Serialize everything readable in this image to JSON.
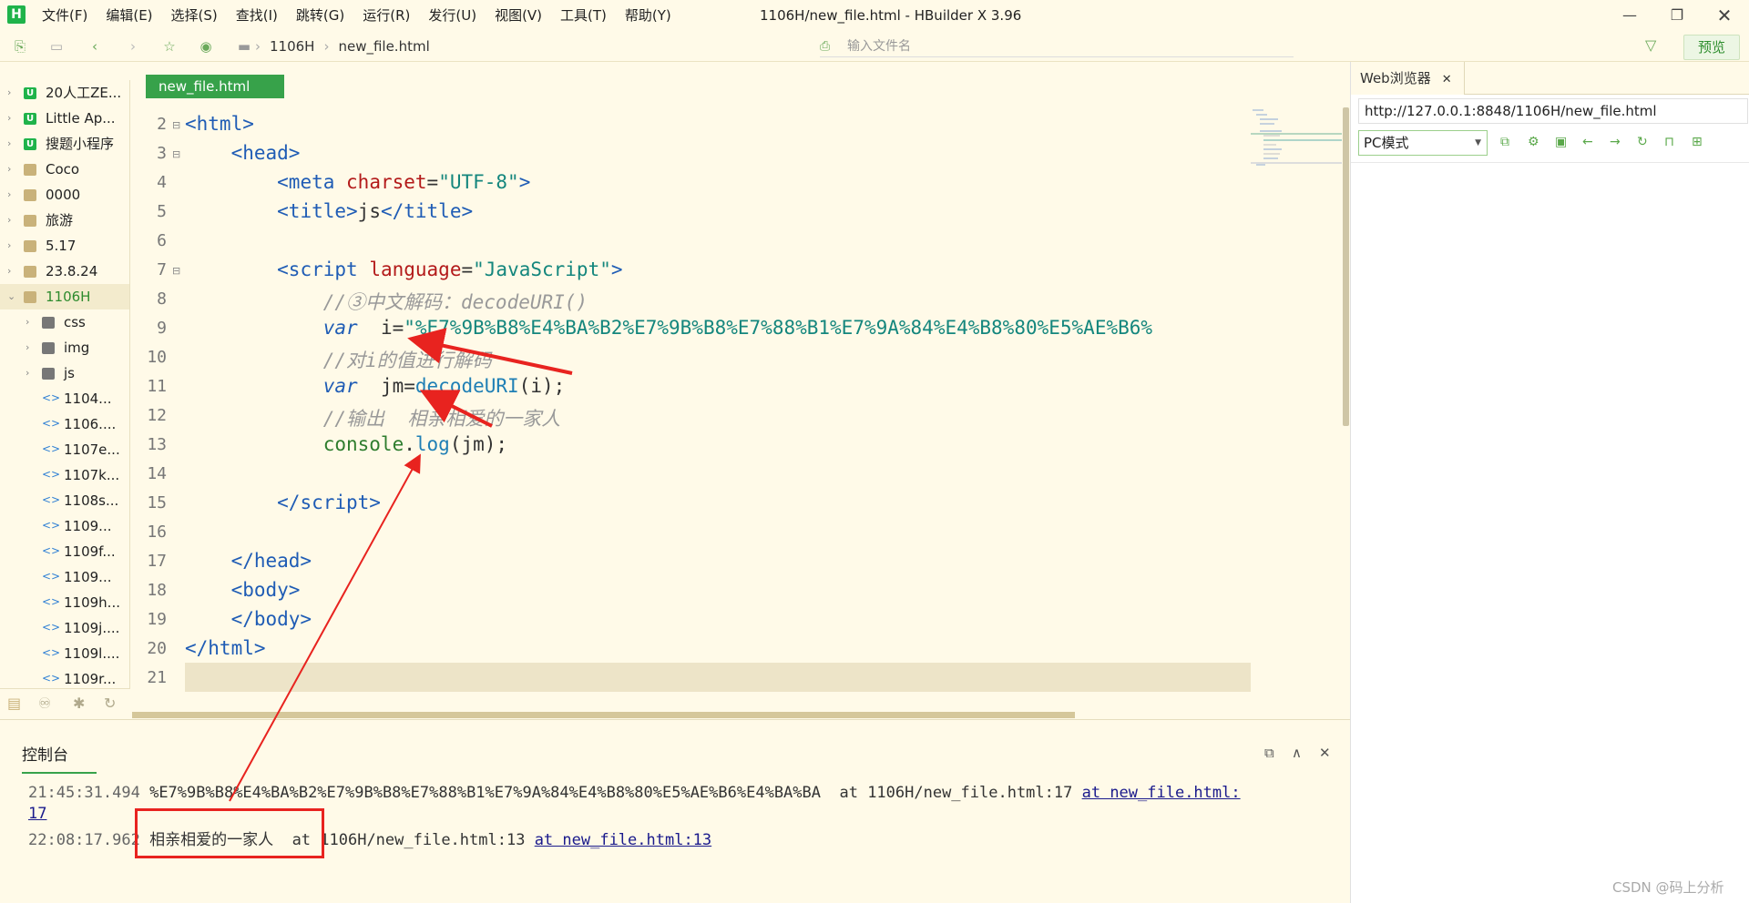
{
  "window": {
    "title": "1106H/new_file.html - HBuilder X 3.96",
    "app_icon": "H"
  },
  "menus": [
    "文件(F)",
    "编辑(E)",
    "选择(S)",
    "查找(I)",
    "跳转(G)",
    "运行(R)",
    "发行(U)",
    "视图(V)",
    "工具(T)",
    "帮助(Y)"
  ],
  "toolbar": {
    "breadcrumb": [
      "1106H",
      "new_file.html"
    ],
    "file_search_placeholder": "输入文件名",
    "preview_label": "预览"
  },
  "sidebar": {
    "items": [
      {
        "label": "20人工ZE...",
        "kind": "uniapp",
        "level": 0
      },
      {
        "label": "Little Ap...",
        "kind": "uniapp",
        "level": 0
      },
      {
        "label": "搜题小程序",
        "kind": "uniapp",
        "level": 0
      },
      {
        "label": "Coco",
        "kind": "folder",
        "level": 0
      },
      {
        "label": "0000",
        "kind": "folder",
        "level": 0
      },
      {
        "label": "旅游",
        "kind": "folder",
        "level": 0
      },
      {
        "label": "5.17",
        "kind": "folder",
        "level": 0
      },
      {
        "label": "23.8.24",
        "kind": "folder",
        "level": 0
      },
      {
        "label": "1106H",
        "kind": "folder",
        "level": 0,
        "selected": true,
        "expanded": true
      },
      {
        "label": "css",
        "kind": "dir",
        "level": 1
      },
      {
        "label": "img",
        "kind": "dir",
        "level": 1
      },
      {
        "label": "js",
        "kind": "dir",
        "level": 1
      },
      {
        "label": "1104...",
        "kind": "html",
        "level": 1
      },
      {
        "label": "1106....",
        "kind": "html",
        "level": 1
      },
      {
        "label": "1107e...",
        "kind": "html",
        "level": 1
      },
      {
        "label": "1107k...",
        "kind": "html",
        "level": 1
      },
      {
        "label": "1108s...",
        "kind": "html",
        "level": 1
      },
      {
        "label": "1109...",
        "kind": "html",
        "level": 1
      },
      {
        "label": "1109f...",
        "kind": "html",
        "level": 1
      },
      {
        "label": "1109...",
        "kind": "html",
        "level": 1
      },
      {
        "label": "1109h...",
        "kind": "html",
        "level": 1
      },
      {
        "label": "1109j....",
        "kind": "html",
        "level": 1
      },
      {
        "label": "1109l....",
        "kind": "html",
        "level": 1
      },
      {
        "label": "1109r...",
        "kind": "html",
        "level": 1
      }
    ]
  },
  "editor": {
    "tab_label": "new_file.html",
    "current_line": 21,
    "line_numbers": [
      "2",
      "3",
      "4",
      "5",
      "6",
      "7",
      "8",
      "9",
      "10",
      "11",
      "12",
      "13",
      "14",
      "15",
      "16",
      "17",
      "18",
      "19",
      "20",
      "21"
    ]
  },
  "browser": {
    "tab_label": "Web浏览器",
    "url": "http://127.0.0.1:8848/1106H/new_file.html",
    "mode": "PC模式"
  },
  "console": {
    "tab_label": "控制台",
    "lines": [
      {
        "time": "21:45:31.494",
        "message": "%E7%9B%B8%E4%BA%B2%E7%9B%B8%E7%88%B1%E7%9A%84%E4%B8%80%E5%AE%B6%E4%BA%BA",
        "at": "at 1106H/new_file.html:17",
        "link": "at new_file.html:",
        "link_cont": "17"
      },
      {
        "time": "22:08:17.962",
        "message": "相亲相爱的一家人",
        "at": "at 1106H/new_file.html:13",
        "link": "at new_file.html:13"
      }
    ]
  },
  "watermark": "CSDN @码上分析",
  "annotation_color": "#e8231f"
}
